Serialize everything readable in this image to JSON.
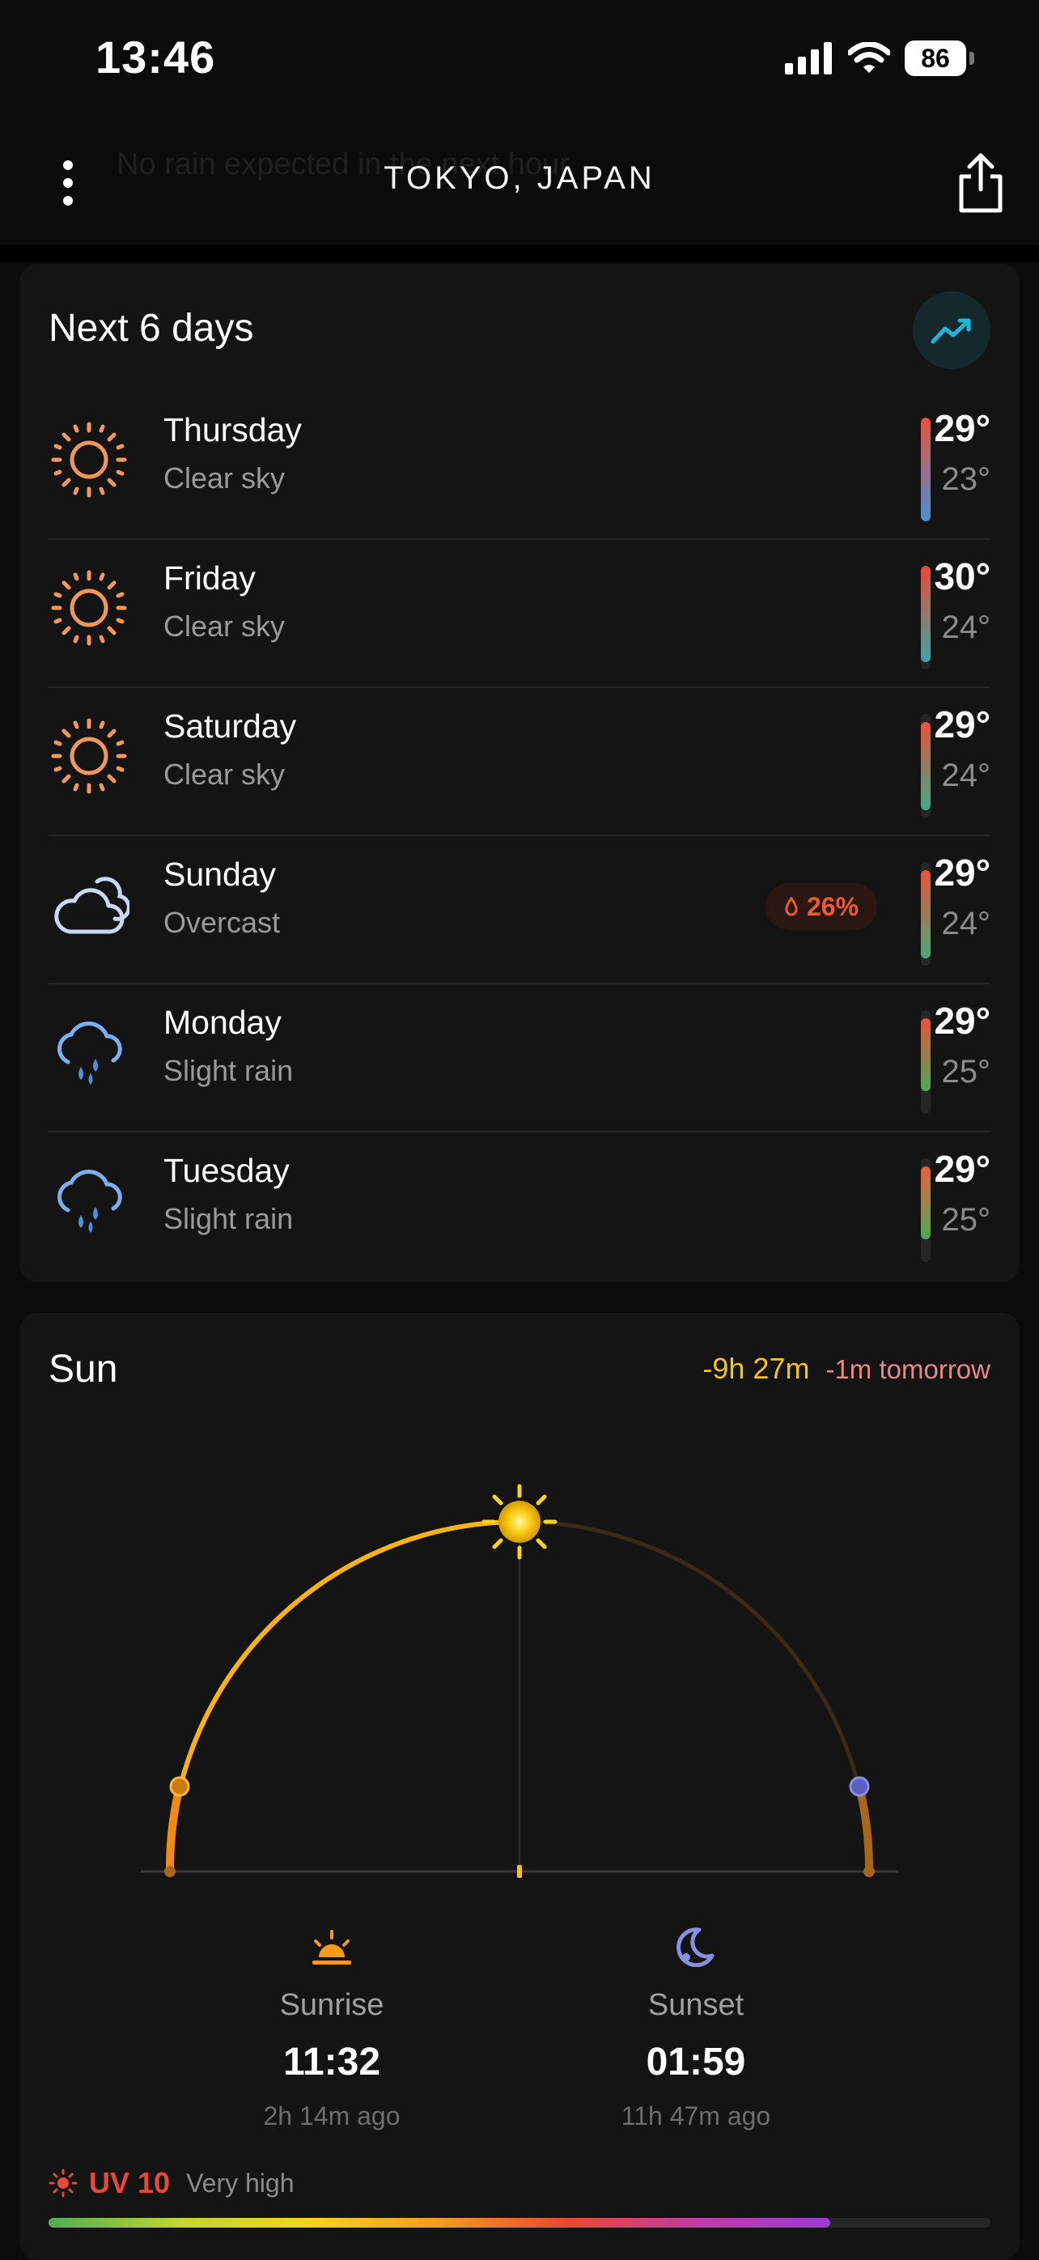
{
  "status_bar": {
    "time": "13:46",
    "battery": "86"
  },
  "header": {
    "title": "TOKYO, JAPAN",
    "ghost_text": "No rain expected in the next hour",
    "icons": {
      "menu": "vertical-dots-icon",
      "share": "share-icon"
    }
  },
  "forecast": {
    "title": "Next 6 days",
    "chart_button_icon": "trend-chart-icon",
    "days": [
      {
        "name": "Thursday",
        "condition": "Clear sky",
        "icon": "sun-icon",
        "high": "29°",
        "low": "23°",
        "precip": "",
        "range": [
          0.0,
          1.0
        ],
        "colors": [
          "#e8523a",
          "#4a8fd6"
        ]
      },
      {
        "name": "Friday",
        "condition": "Clear sky",
        "icon": "sun-icon",
        "high": "30°",
        "low": "24°",
        "precip": "",
        "range": [
          0.0,
          0.93
        ],
        "colors": [
          "#e84a3a",
          "#3fa3a0"
        ]
      },
      {
        "name": "Saturday",
        "condition": "Clear sky",
        "icon": "sun-icon",
        "high": "29°",
        "low": "24°",
        "precip": "",
        "range": [
          0.08,
          0.93
        ],
        "colors": [
          "#e8523a",
          "#3fa88a"
        ]
      },
      {
        "name": "Sunday",
        "condition": "Overcast",
        "icon": "cloud-icon",
        "high": "29°",
        "low": "24°",
        "precip": "26%",
        "range": [
          0.08,
          0.93
        ],
        "colors": [
          "#e8523a",
          "#4aa87a"
        ]
      },
      {
        "name": "Monday",
        "condition": "Slight rain",
        "icon": "cloud-rain-icon",
        "high": "29°",
        "low": "25°",
        "precip": "",
        "range": [
          0.08,
          0.78
        ],
        "colors": [
          "#e8523a",
          "#4aa85a"
        ]
      },
      {
        "name": "Tuesday",
        "condition": "Slight rain",
        "icon": "cloud-rain-icon",
        "high": "29°",
        "low": "25°",
        "precip": "",
        "range": [
          0.08,
          0.78
        ],
        "colors": [
          "#e8603a",
          "#4aa85a"
        ]
      }
    ]
  },
  "sun": {
    "title": "Sun",
    "day_length": "-9h 27m",
    "tomorrow": "-1m tomorrow",
    "sunrise": {
      "label": "Sunrise",
      "time": "11:32",
      "ago": "2h 14m ago",
      "icon": "sunrise-icon"
    },
    "sunset": {
      "label": "Sunset",
      "time": "01:59",
      "ago": "11h 47m ago",
      "icon": "moon-icon"
    },
    "day_progress": 0.5
  },
  "uv": {
    "value": "UV 10",
    "description": "Very high",
    "level": 0.83,
    "icon": "uv-sun-icon"
  }
}
